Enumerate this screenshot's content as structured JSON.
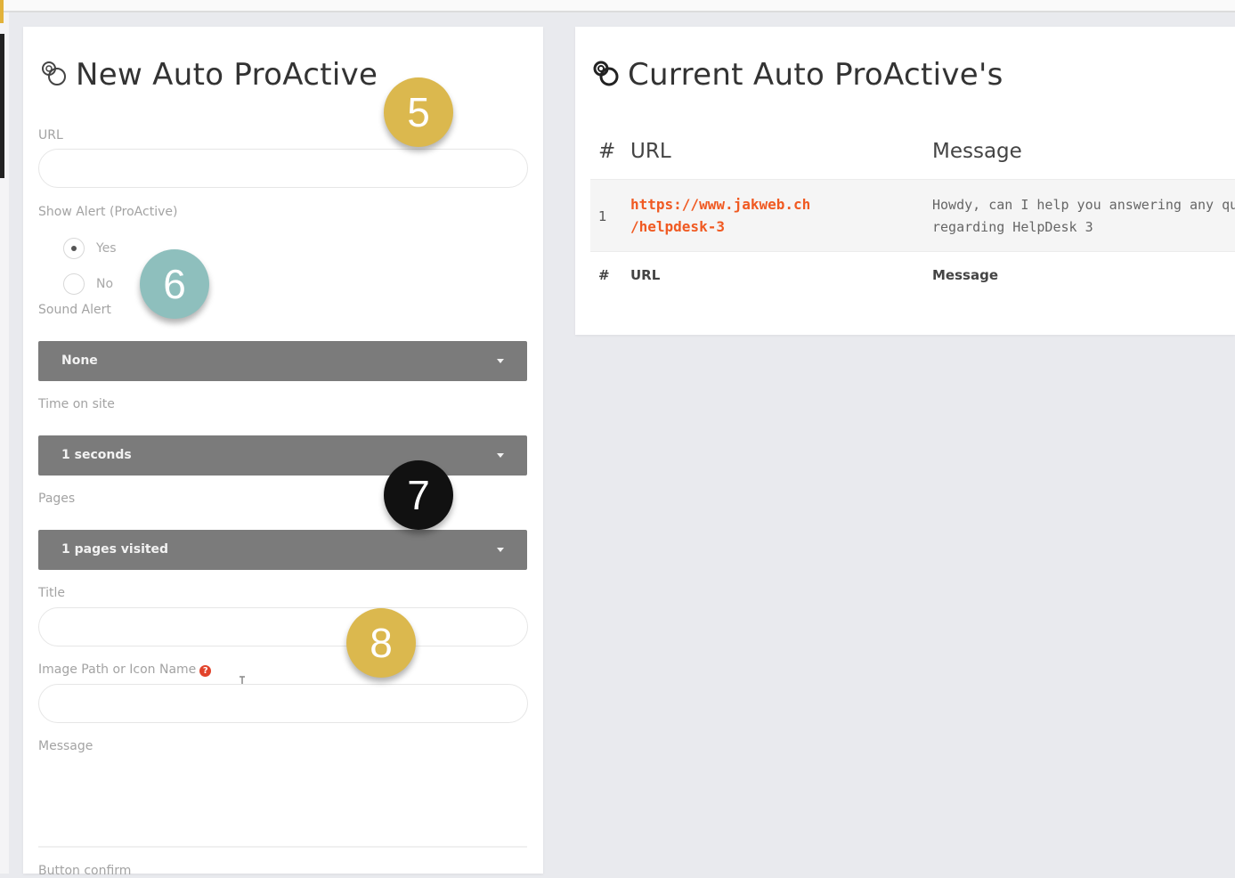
{
  "new_form": {
    "title": "New Auto ProActive",
    "url_label": "URL",
    "show_alert_label": "Show Alert (ProActive)",
    "show_alert_options": [
      "Yes",
      "No"
    ],
    "show_alert_selected": "Yes",
    "sound_alert_label": "Sound Alert",
    "sound_alert_value": "None",
    "time_on_site_label": "Time on site",
    "time_on_site_value": "1 seconds",
    "pages_label": "Pages",
    "pages_value": "1 pages visited",
    "title_label": "Title",
    "image_label": "Image Path or Icon Name",
    "help_glyph": "?",
    "message_label": "Message",
    "button_confirm_label": "Button confirm"
  },
  "current_list": {
    "title": "Current Auto ProActive's",
    "columns": [
      "#",
      "URL",
      "Message"
    ],
    "rows": [
      {
        "num": "1",
        "url_line1": "https://www.jakweb.ch",
        "url_line2": "/helpdesk-3",
        "msg_line1": "Howdy, can I help you answering any qu",
        "msg_line2": "regarding HelpDesk 3"
      }
    ],
    "footer": [
      "#",
      "URL",
      "Message"
    ]
  },
  "callouts": [
    {
      "label": "5",
      "color": "#dbb84e"
    },
    {
      "label": "6",
      "color": "#8ebfbd"
    },
    {
      "label": "7",
      "color": "#111111"
    },
    {
      "label": "8",
      "color": "#dbb84e"
    }
  ],
  "colors": {
    "link": "#f05a22",
    "select_bg": "#7b7b7b",
    "page_bg": "#e9eaee"
  }
}
